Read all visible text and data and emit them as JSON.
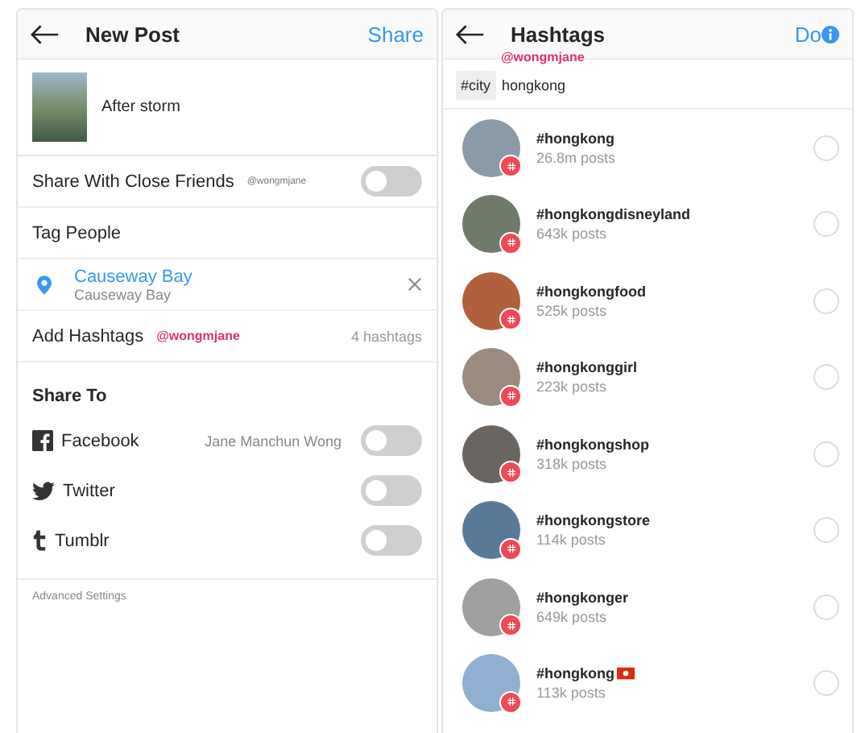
{
  "new_post": {
    "title": "New Post",
    "share_button": "Share",
    "caption": "After storm",
    "close_friends": {
      "label": "Share With Close Friends",
      "handle": "@wongmjane",
      "on": false
    },
    "tag_people": "Tag People",
    "location": {
      "name": "Causeway Bay",
      "subtitle": "Causeway Bay"
    },
    "hashtags": {
      "label": "Add Hashtags",
      "handle": "@wongmjane",
      "count": "4 hashtags"
    },
    "share_to": {
      "title": "Share To",
      "services": [
        {
          "kind": "facebook",
          "label": "Facebook",
          "account": "Jane Manchun Wong",
          "on": false
        },
        {
          "kind": "twitter",
          "label": "Twitter",
          "on": false
        },
        {
          "kind": "tumblr",
          "label": "Tumblr",
          "on": false
        }
      ]
    },
    "advanced": "Advanced Settings"
  },
  "hashtags_screen": {
    "title": "Hashtags",
    "handle": "@wongmjane",
    "done_button": "Do",
    "category": "#city",
    "query": "hongkong",
    "results": [
      {
        "tag": "#hongkong",
        "posts": "26.8m posts",
        "selected": false
      },
      {
        "tag": "#hongkongdisneyland",
        "posts": "643k posts",
        "selected": false
      },
      {
        "tag": "#hongkongfood",
        "posts": "525k posts",
        "selected": false
      },
      {
        "tag": "#hongkonggirl",
        "posts": "223k posts",
        "selected": false
      },
      {
        "tag": "#hongkongshop",
        "posts": "318k posts",
        "selected": false
      },
      {
        "tag": "#hongkongstore",
        "posts": "114k posts",
        "selected": false
      },
      {
        "tag": "#hongkonger",
        "posts": "649k posts",
        "selected": false
      },
      {
        "tag": "#hongkong",
        "flag": true,
        "posts": "113k posts",
        "selected": false
      }
    ]
  }
}
